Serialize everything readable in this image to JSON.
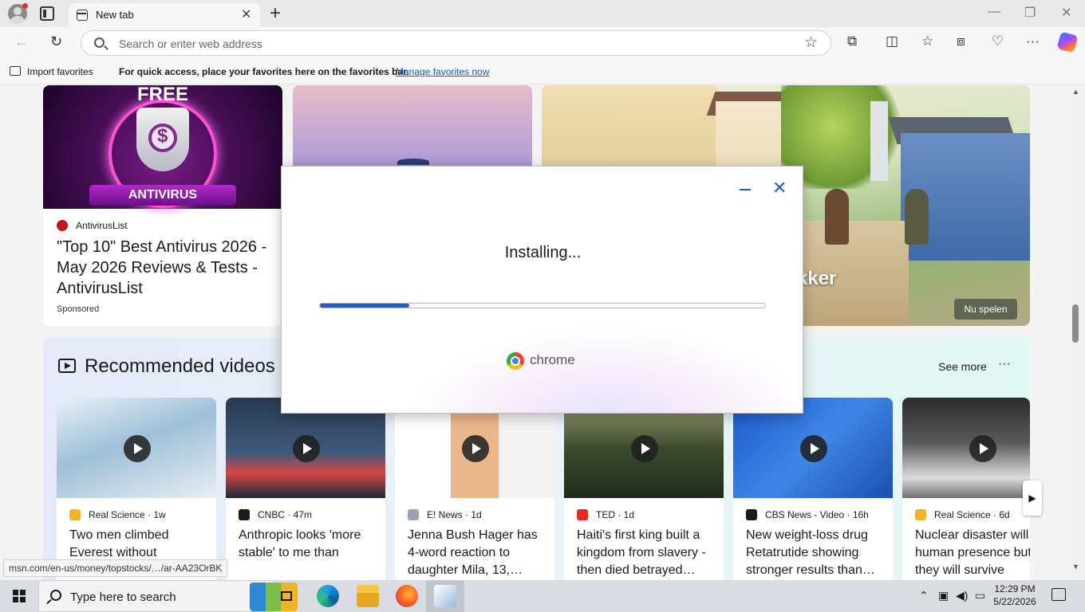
{
  "browser": {
    "tab_title": "New tab",
    "tab_close": "✕",
    "new_tab": "+",
    "address_placeholder": "Search or enter web address",
    "window_controls": {
      "minimize": "—",
      "restore": "❐",
      "close": "✕"
    },
    "nav": {
      "back": "←",
      "reload": "↻",
      "favorite": "☆"
    },
    "toolbar_icons": {
      "extensions": "⧉",
      "split": "◫",
      "favorites": "☆",
      "collections": "⧈",
      "performance": "♡",
      "menu": "···"
    }
  },
  "favorites_bar": {
    "import_label": "Import favorites",
    "hint": "For quick access, place your favorites here on the favorites bar.",
    "manage_link": "Manage favorites now"
  },
  "feed": {
    "ad": {
      "badge_top": "FREE",
      "dollar": "$",
      "badge_bottom": "ANTIVIRUS",
      "source": "AntivirusList",
      "title": "\"Top 10\" Best Antivirus 2026 - May 2026 Reviews & Tests - AntivirusList",
      "sponsored": "Sponsored"
    },
    "game": {
      "title_partial": "kker",
      "play_button": "Nu spelen"
    },
    "videos": {
      "section_title": "Recommended videos",
      "see_more": "See more",
      "more": "···",
      "next": "▶",
      "items": [
        {
          "source": "Real Science · 1w",
          "title": "Two men climbed Everest without",
          "icon_color": "#f0b429",
          "thumb": "linear-gradient(160deg,#e8f1f7,#9ec0d8 45%,#e9eef2)"
        },
        {
          "source": "CNBC · 47m",
          "title": "Anthropic looks 'more stable' to me than",
          "icon_color": "#1a1a1a",
          "thumb": "linear-gradient(#2a3950,#3f5a7a 55%,#d44646 75%,#1e2a3a)"
        },
        {
          "source": "E! News · 1d",
          "title": "Jenna Bush Hager has 4-word reaction to daughter Mila, 13,…",
          "icon_color": "#9aa4b0",
          "thumb": "linear-gradient(90deg,#ffffff 0 35%,#e8b78c 35% 65%,#f3f3f3 65%)"
        },
        {
          "source": "TED · 1d",
          "title": "Haiti's first king built a kingdom from slavery - then died betrayed…",
          "icon_color": "#e62b1e",
          "thumb": "linear-gradient(#a5a57e,#3c4a2c 50%,#1f2a1a)"
        },
        {
          "source": "CBS News - Video · 16h",
          "title": "New weight-loss drug Retatrutide showing stronger results than…",
          "icon_color": "#1a1a1a",
          "thumb": "linear-gradient(135deg,#1c57c9,#3f86e8 50%,#1a4fb0)"
        },
        {
          "source": "Real Science · 6d",
          "title": "Nuclear disaster will end human presence but they will survive",
          "icon_color": "#f0b429",
          "thumb": "linear-gradient(#2b2b2b,#5a5a5a 45%,#dcdcdc 80%,#707070)"
        }
      ]
    }
  },
  "status_bar_url": "msn.com/en-us/money/topstocks/…/ar-AA23OrBK",
  "installer": {
    "minimize": "—",
    "close": "✕",
    "status": "Installing...",
    "progress_percent": 20,
    "brand": "chrome"
  },
  "taskbar": {
    "search_placeholder": "Type here to search",
    "time": "12:29 PM",
    "date": "5/22/2026",
    "tray_chevron": "⌃"
  }
}
